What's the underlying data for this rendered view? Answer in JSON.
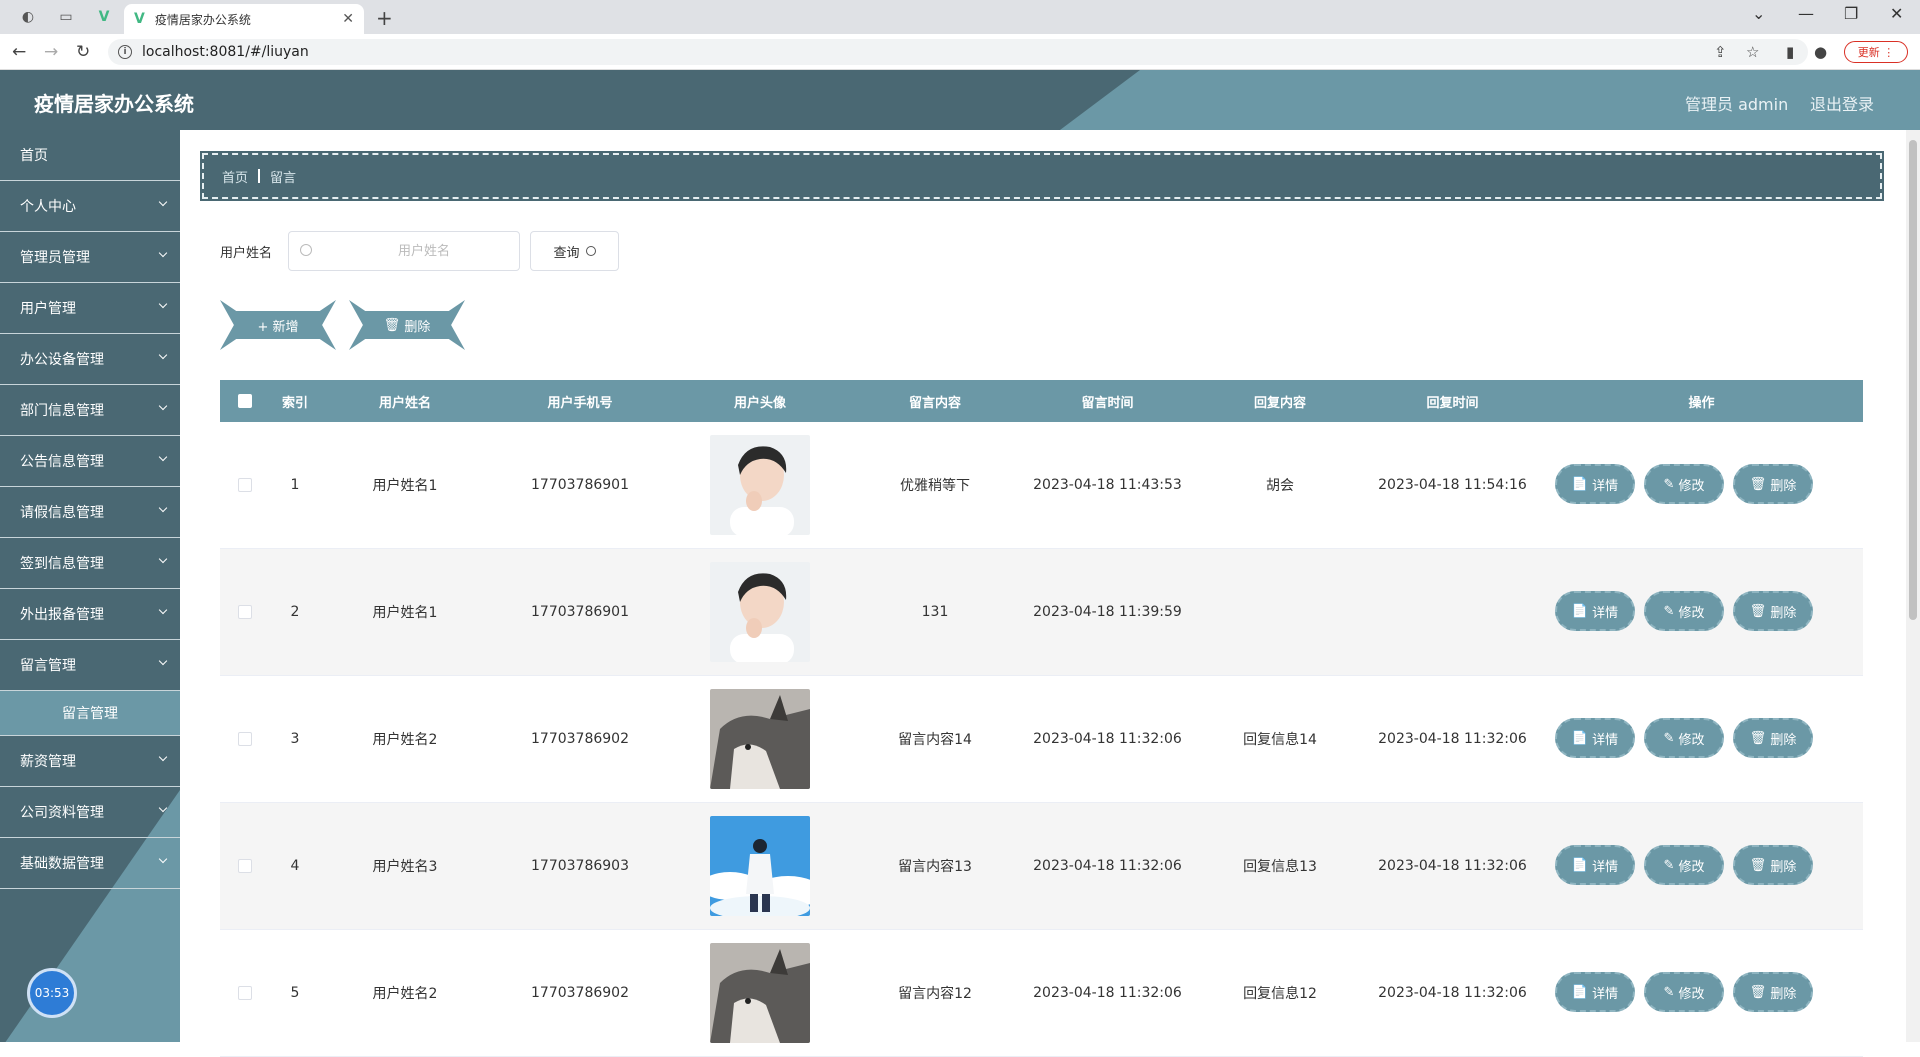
{
  "browser": {
    "tab_title": "疫情居家办公系统",
    "url": "localhost:8081/#/liuyan",
    "update_label": "更新"
  },
  "header": {
    "app_title": "疫情居家办公系统",
    "user": "管理员 admin",
    "logout": "退出登录"
  },
  "sidebar": {
    "items": [
      {
        "label": "首页"
      },
      {
        "label": "个人中心"
      },
      {
        "label": "管理员管理"
      },
      {
        "label": "用户管理"
      },
      {
        "label": "办公设备管理"
      },
      {
        "label": "部门信息管理"
      },
      {
        "label": "公告信息管理"
      },
      {
        "label": "请假信息管理"
      },
      {
        "label": "签到信息管理"
      },
      {
        "label": "外出报备管理"
      },
      {
        "label": "留言管理"
      },
      {
        "label": "薪资管理"
      },
      {
        "label": "公司资料管理"
      },
      {
        "label": "基础数据管理"
      }
    ],
    "active_sub": "留言管理",
    "timer": "03:53"
  },
  "breadcrumb": {
    "home": "首页",
    "current": "留言"
  },
  "search": {
    "label": "用户姓名",
    "placeholder": "用户姓名",
    "button": "查询"
  },
  "actions": {
    "add": "+ 新增",
    "delete": "删除"
  },
  "table": {
    "headers": [
      "索引",
      "用户姓名",
      "用户手机号",
      "用户头像",
      "留言内容",
      "留言时间",
      "回复内容",
      "回复时间",
      "操作"
    ],
    "op_labels": {
      "detail": "详情",
      "edit": "修改",
      "delete": "删除"
    },
    "rows": [
      {
        "index": "1",
        "name": "用户姓名1",
        "phone": "17703786901",
        "avatar": "boy",
        "content": "优雅稍等下",
        "time": "2023-04-18 11:43:53",
        "reply": "胡会",
        "reply_time": "2023-04-18 11:54:16"
      },
      {
        "index": "2",
        "name": "用户姓名1",
        "phone": "17703786901",
        "avatar": "boy",
        "content": "131",
        "time": "2023-04-18 11:39:59",
        "reply": "",
        "reply_time": ""
      },
      {
        "index": "3",
        "name": "用户姓名2",
        "phone": "17703786902",
        "avatar": "husky",
        "content": "留言内容14",
        "time": "2023-04-18 11:32:06",
        "reply": "回复信息14",
        "reply_time": "2023-04-18 11:32:06"
      },
      {
        "index": "4",
        "name": "用户姓名3",
        "phone": "17703786903",
        "avatar": "sky",
        "content": "留言内容13",
        "time": "2023-04-18 11:32:06",
        "reply": "回复信息13",
        "reply_time": "2023-04-18 11:32:06"
      },
      {
        "index": "5",
        "name": "用户姓名2",
        "phone": "17703786902",
        "avatar": "husky",
        "content": "留言内容12",
        "time": "2023-04-18 11:32:06",
        "reply": "回复信息12",
        "reply_time": "2023-04-18 11:32:06"
      }
    ]
  },
  "colors": {
    "primary": "#4a6873",
    "accent": "#6b98a6"
  }
}
